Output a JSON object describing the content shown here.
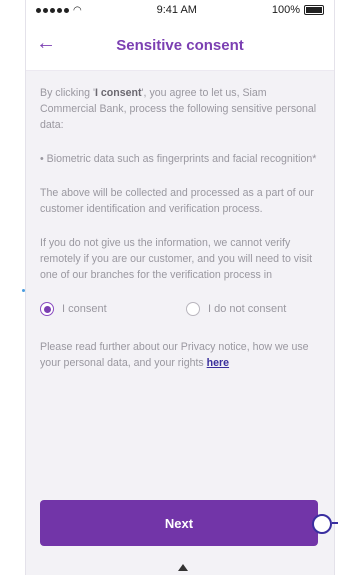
{
  "status_bar": {
    "time": "9:41 AM",
    "battery": "100%"
  },
  "header": {
    "back_icon": "arrow-left-icon",
    "title": "Sensitive consent"
  },
  "body": {
    "intro_pre": "By clicking '",
    "intro_bold": "I consent",
    "intro_post": "', you agree to let us, Siam Commercial Bank, process the following sensitive personal data:",
    "bullet": "• Biometric data such as fingerprints and facial recognition*",
    "purpose": "The above will be collected and processed as a part of our customer identification and verification process.",
    "warning": "If you do not give us the information, we cannot verify remotely if you are our customer, and you will need to visit one of our branches for the verification process in"
  },
  "consent": {
    "options": [
      {
        "label": "I consent",
        "selected": true
      },
      {
        "label": "I do not consent",
        "selected": false
      }
    ]
  },
  "privacy": {
    "text": "Please read further about our Privacy notice, how we use your personal data, and your rights ",
    "link": "here"
  },
  "actions": {
    "next_label": "Next"
  },
  "colors": {
    "accent": "#7b3fb2",
    "button": "#7235a8"
  }
}
